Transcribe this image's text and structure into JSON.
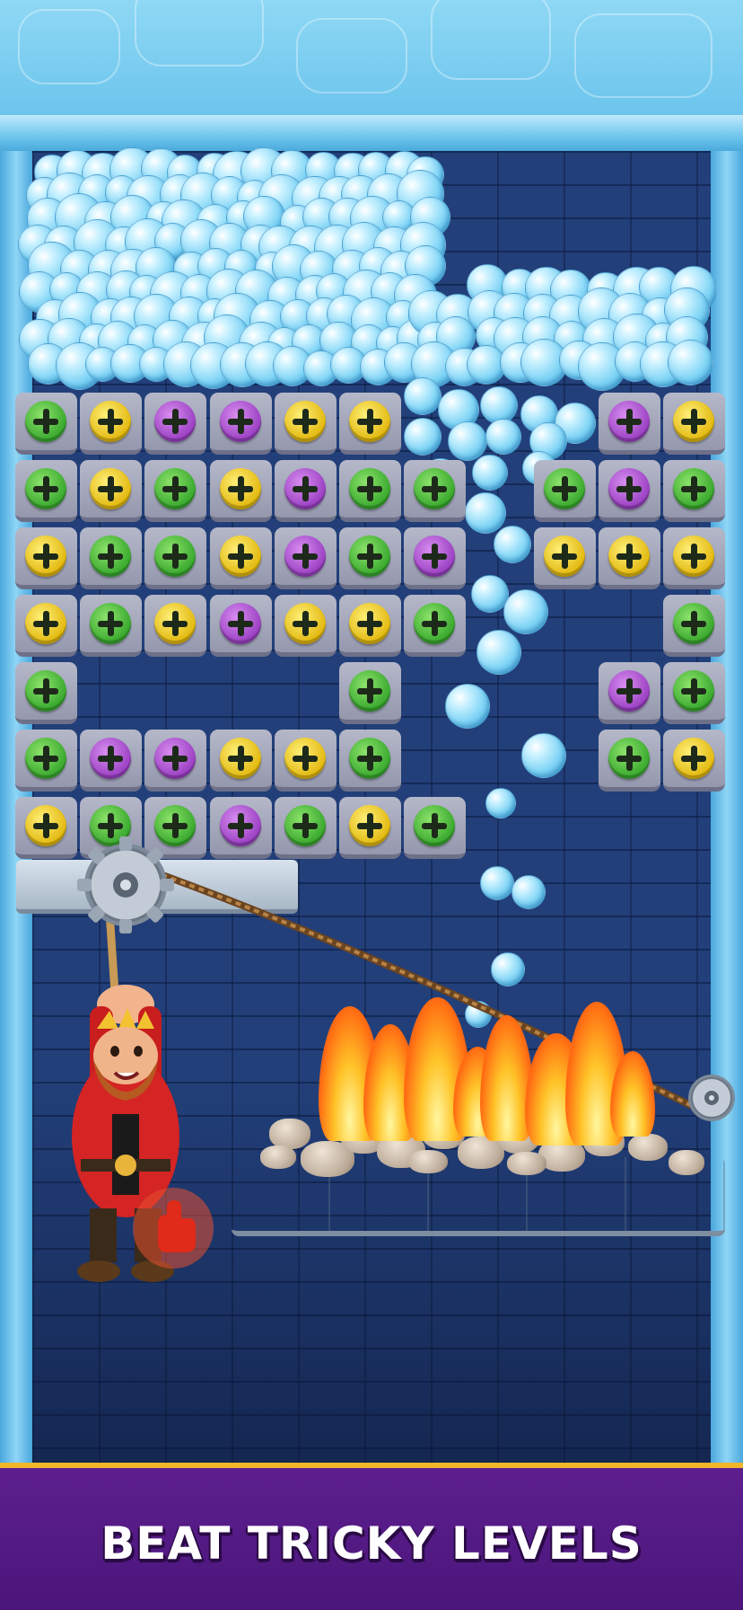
{
  "banner": {
    "text": "BEAT TRICKY LEVELS"
  },
  "colors": {
    "banner_bg": "#4a157a",
    "banner_border": "#f1b62a",
    "wall": "#223f79",
    "ice": "#7dd3f5",
    "screw_green": "#38a82d",
    "screw_yellow": "#e2b80e",
    "screw_purple": "#9a3fc2"
  },
  "board": {
    "rows": [
      [
        "green",
        "yellow",
        "purple",
        "purple",
        "yellow",
        "yellow",
        null,
        null,
        null,
        "purple",
        "yellow"
      ],
      [
        "green",
        "yellow",
        "green",
        "yellow",
        "purple",
        "green",
        "green",
        null,
        "green",
        "purple",
        "green"
      ],
      [
        "yellow",
        "green",
        "green",
        "yellow",
        "purple",
        "green",
        "purple",
        null,
        "yellow",
        "yellow",
        "yellow"
      ],
      [
        "yellow",
        "green",
        "yellow",
        "purple",
        "yellow",
        "yellow",
        "green",
        null,
        null,
        null,
        "green"
      ],
      [
        "green",
        null,
        null,
        null,
        null,
        "green",
        null,
        null,
        null,
        "purple",
        "green"
      ],
      [
        "green",
        "purple",
        "purple",
        "yellow",
        "yellow",
        "green",
        null,
        null,
        null,
        "green",
        "yellow"
      ],
      [
        "yellow",
        "green",
        "green",
        "purple",
        "green",
        "yellow",
        "green",
        null,
        null,
        null,
        null
      ]
    ]
  },
  "characters": {
    "king": {
      "name_icon": "king-character",
      "state": "hanging-from-rope"
    }
  },
  "hazards": {
    "fire_pit": "fire-hazard"
  },
  "hint": {
    "icon": "tap-hand-icon"
  }
}
